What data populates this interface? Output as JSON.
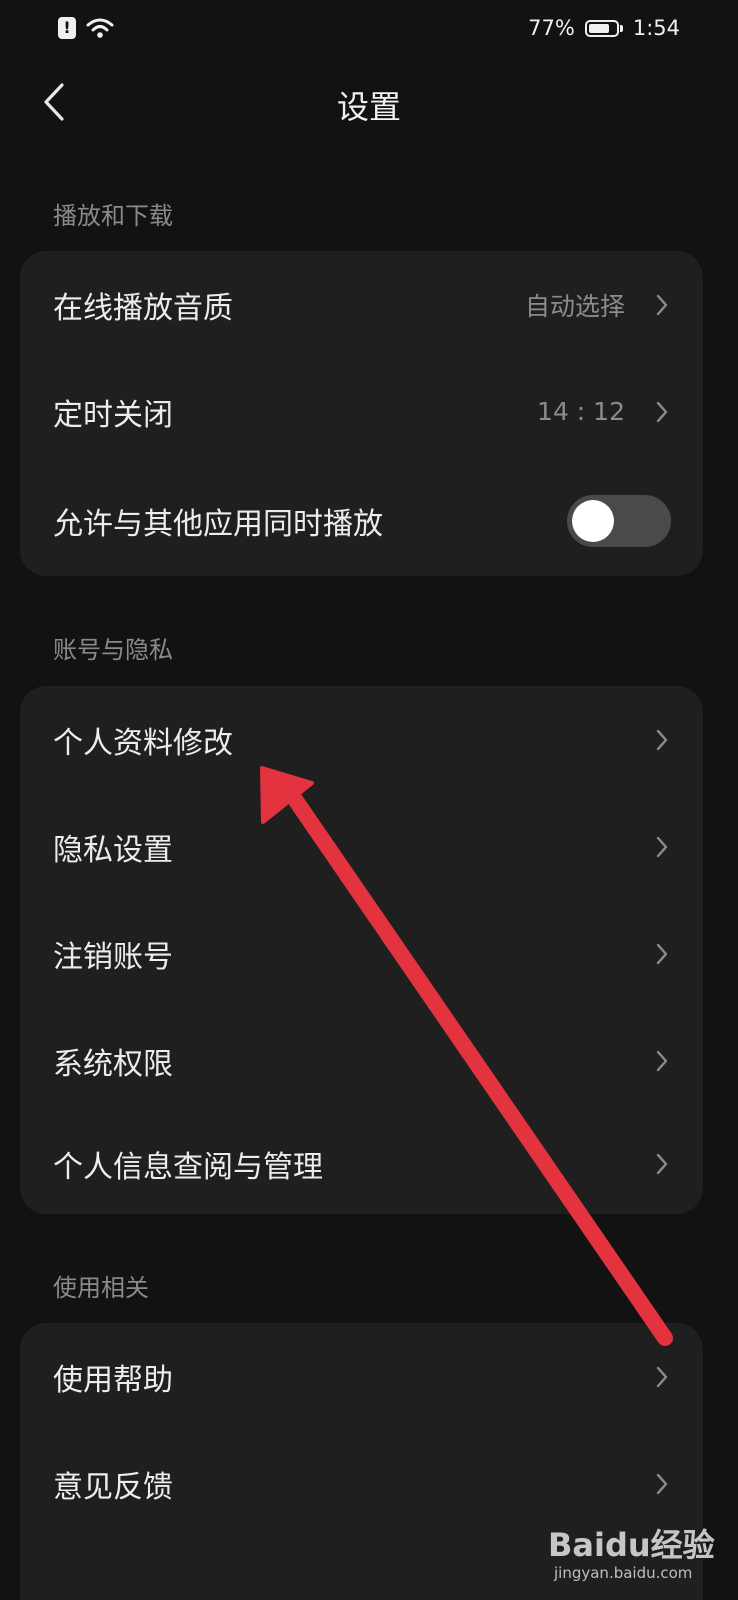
{
  "status_bar": {
    "battery": "77%",
    "time": "1:54"
  },
  "header": {
    "title": "设置"
  },
  "sections": {
    "playback": {
      "label": "播放和下载",
      "items": [
        {
          "label": "在线播放音质",
          "value": "自动选择"
        },
        {
          "label": "定时关闭",
          "value": "14 : 12"
        },
        {
          "label": "允许与其他应用同时播放"
        }
      ]
    },
    "account": {
      "label": "账号与隐私",
      "items": [
        {
          "label": "个人资料修改"
        },
        {
          "label": "隐私设置"
        },
        {
          "label": "注销账号"
        },
        {
          "label": "系统权限"
        },
        {
          "label": "个人信息查阅与管理"
        }
      ]
    },
    "usage": {
      "label": "使用相关",
      "items": [
        {
          "label": "使用帮助"
        },
        {
          "label": "意见反馈"
        }
      ]
    }
  },
  "colors": {
    "background": "#121212",
    "card": "#1f1f1f",
    "accent_arrow": "#e3333f"
  },
  "watermark": {
    "logo_text": "Baidu经验",
    "url": "jingyan.baidu.com"
  }
}
